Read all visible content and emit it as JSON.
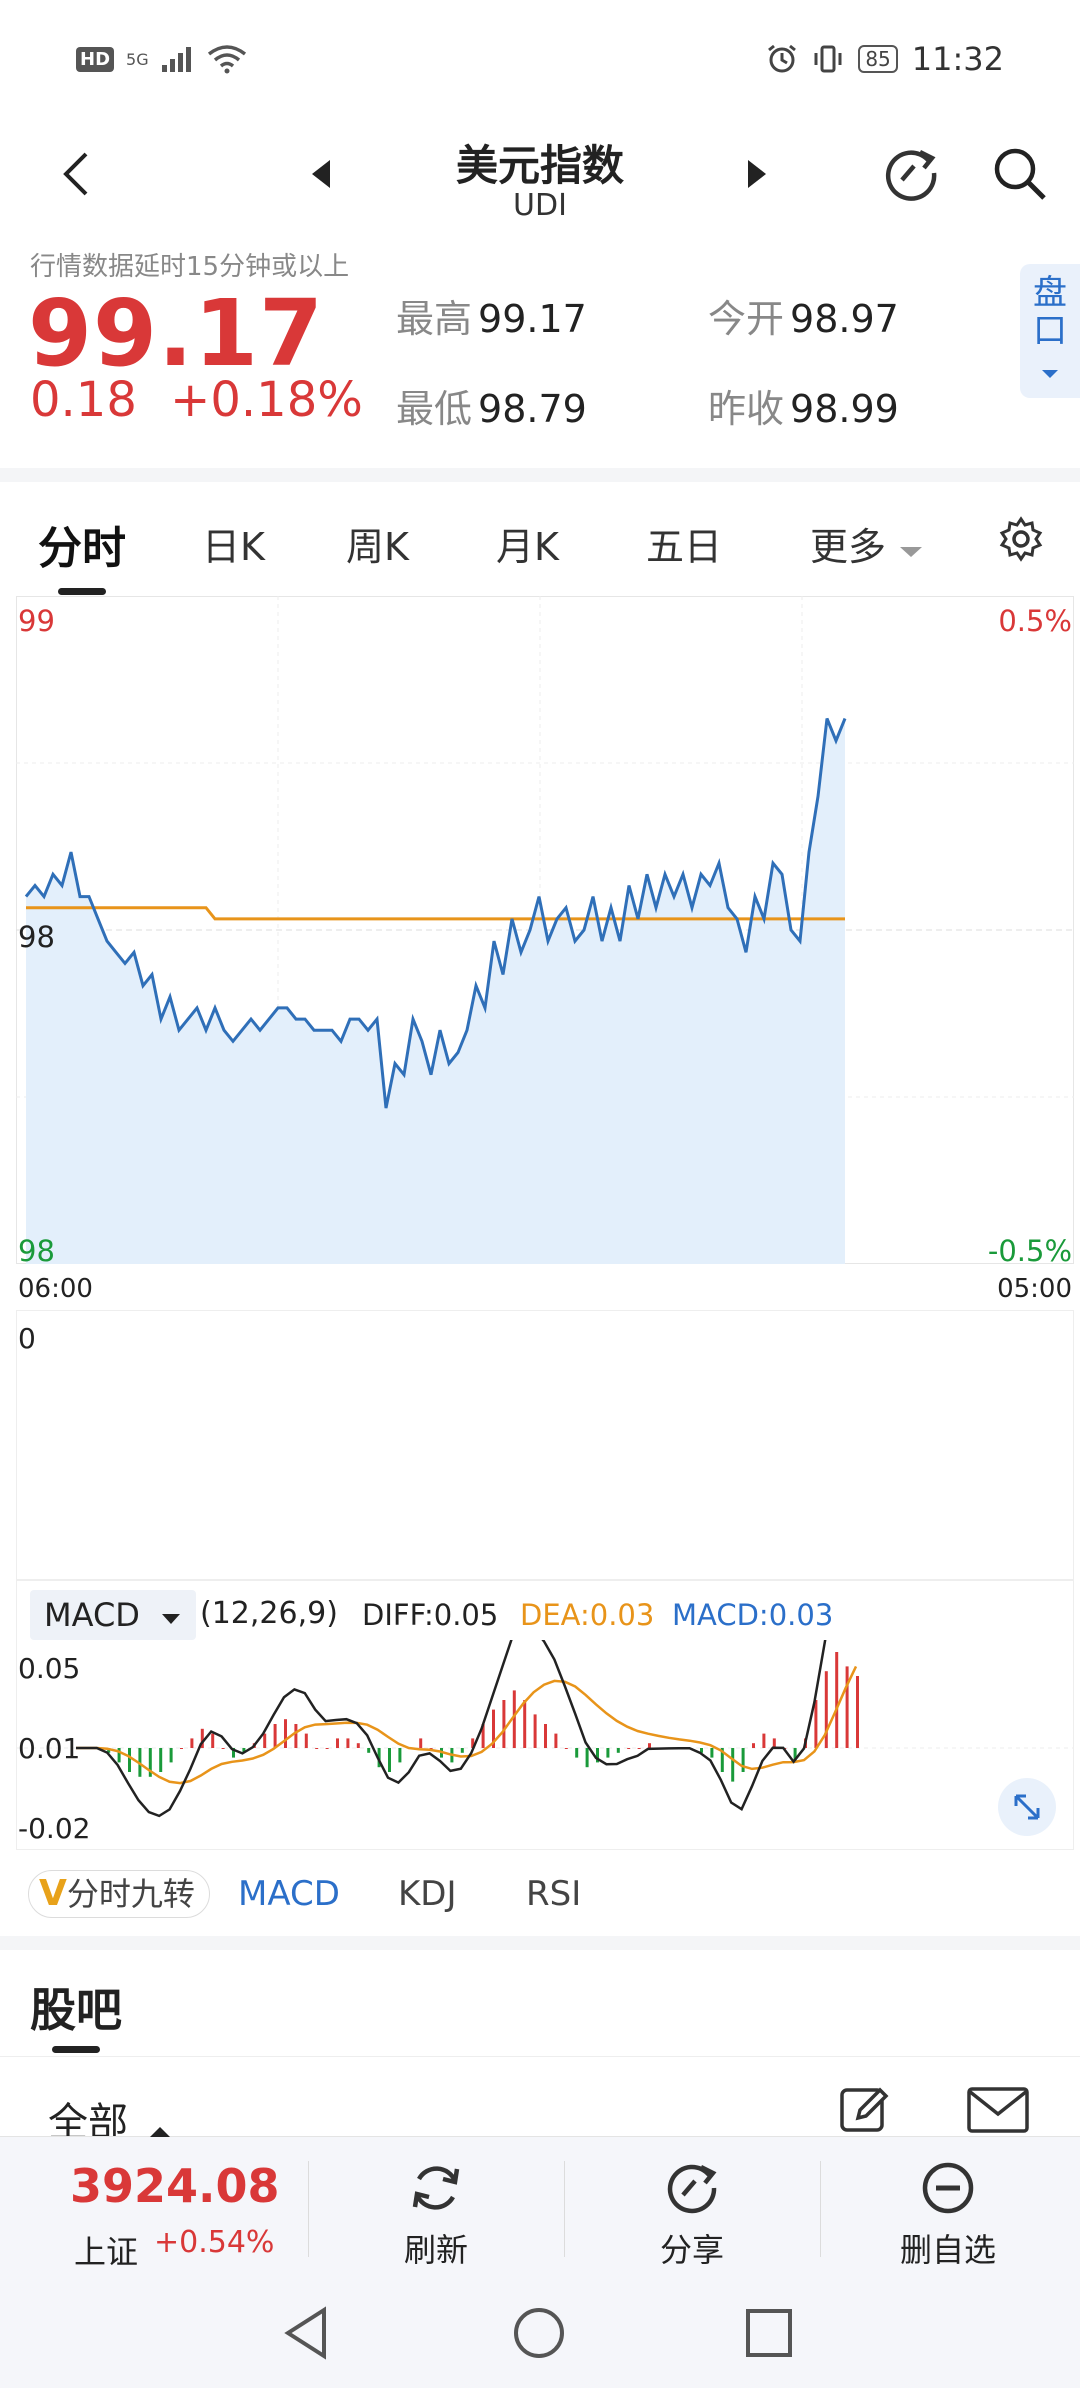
{
  "status_bar": {
    "network_badge": "HD",
    "signal_label": "5G",
    "battery": "85",
    "time": "11:32"
  },
  "header": {
    "title": "美元指数",
    "code": "UDI"
  },
  "quote": {
    "delay_notice": "行情数据延时15分钟或以上",
    "price": "99.17",
    "change": "0.18",
    "change_pct": "+0.18%",
    "high_label": "最高",
    "high": "99.17",
    "open_label": "今开",
    "open": "98.97",
    "low_label": "最低",
    "low": "98.79",
    "prev_close_label": "昨收",
    "prev_close": "98.99",
    "pankou_label": "盘口"
  },
  "tabs": [
    "分时",
    "日K",
    "周K",
    "月K",
    "五日",
    "更多"
  ],
  "chart": {
    "y_top_label": "99",
    "y_mid_label": "98",
    "y_bottom_label": "98",
    "pct_top_label": "0.5%",
    "pct_bottom_label": "-0.5%",
    "x_start": "06:00",
    "x_end": "05:00",
    "volume_label": "0"
  },
  "macd": {
    "selector": "MACD",
    "params": "(12,26,9)",
    "diff": "DIFF:0.05",
    "dea": "DEA:0.03",
    "macd": "MACD:0.03",
    "y_top": "0.05",
    "y_mid": "0.01",
    "y_bottom": "-0.02"
  },
  "indicator_tabs": {
    "chip": "分时九转",
    "chip_badge": "V",
    "items": [
      "MACD",
      "KDJ",
      "RSI"
    ]
  },
  "guba": {
    "title": "股吧",
    "filter": "全部"
  },
  "toolbar": {
    "index_value": "3924.08",
    "index_name": "上证",
    "index_pct": "+0.54%",
    "refresh": "刷新",
    "share": "分享",
    "remove_watch": "删自选"
  },
  "colors": {
    "up": "#d93838",
    "down": "#1a9a3a",
    "price_line": "#2f6fb8",
    "avg_line": "#e8941a",
    "accent": "#2b6fc9"
  },
  "chart_data": {
    "type": "line",
    "series": [
      {
        "values": [
          98.98,
          98.99,
          98.98,
          99.0,
          98.99,
          99.02,
          98.98,
          98.98,
          98.96,
          98.94,
          98.93,
          98.92,
          98.93,
          98.9,
          98.91,
          98.87,
          98.89,
          98.86,
          98.87,
          98.88,
          98.86,
          98.88,
          98.86,
          98.85,
          98.86,
          98.87,
          98.86,
          98.87,
          98.88,
          98.88,
          98.87,
          98.87,
          98.86,
          98.86,
          98.86,
          98.85,
          98.87,
          98.87,
          98.86,
          98.87,
          98.79,
          98.83,
          98.82,
          98.87,
          98.85,
          98.82,
          98.86,
          98.83,
          98.84,
          98.86,
          98.9,
          98.88,
          98.94,
          98.91,
          98.96,
          98.93,
          98.95,
          98.98,
          98.94,
          98.96,
          98.97,
          98.94,
          98.95,
          98.98,
          98.94,
          98.97,
          98.94,
          98.99,
          98.96,
          99.0,
          98.97,
          99.0,
          98.98,
          99.0,
          98.97,
          99.0,
          98.99,
          99.01,
          98.97,
          98.96,
          98.93,
          98.98,
          98.96,
          99.01,
          99.0,
          98.95,
          98.94,
          99.02,
          99.07,
          99.14,
          99.12,
          99.14
        ]
      },
      {
        "values": [
          98.97,
          98.97,
          98.97,
          98.97,
          98.97,
          98.97,
          98.97,
          98.97,
          98.97,
          98.97,
          98.97,
          98.97,
          98.97,
          98.97,
          98.97,
          98.97,
          98.97,
          98.97,
          98.97,
          98.97,
          98.97,
          98.96,
          98.96,
          98.96,
          98.96,
          98.96,
          98.96,
          98.96,
          98.96,
          98.96,
          98.96,
          98.96,
          98.96,
          98.96,
          98.96,
          98.96,
          98.96,
          98.96,
          98.96,
          98.96,
          98.96,
          98.96,
          98.96,
          98.96,
          98.96,
          98.96,
          98.96,
          98.96,
          98.96,
          98.96,
          98.96,
          98.96,
          98.96,
          98.96,
          98.96,
          98.96,
          98.96,
          98.96,
          98.96,
          98.96,
          98.96,
          98.96,
          98.96,
          98.96,
          98.96,
          98.96,
          98.96,
          98.96,
          98.96,
          98.96,
          98.96,
          98.96,
          98.96,
          98.96,
          98.96,
          98.96,
          98.96,
          98.96,
          98.96,
          98.96,
          98.96,
          98.96,
          98.96,
          98.96,
          98.96,
          98.96,
          98.96,
          98.96,
          98.96,
          98.96,
          98.96,
          98.96
        ]
      }
    ],
    "macd_hist": [
      0.0,
      0.0,
      0.0,
      -0.002,
      -0.006,
      -0.01,
      -0.012,
      -0.012,
      -0.01,
      -0.006,
      0.0,
      0.004,
      0.008,
      0.006,
      0.0,
      -0.004,
      -0.002,
      0.002,
      0.006,
      0.01,
      0.012,
      0.01,
      0.006,
      0.0,
      0.0,
      0.004,
      0.004,
      0.002,
      -0.002,
      -0.008,
      -0.01,
      -0.006,
      0.0,
      0.004,
      0.0,
      -0.004,
      -0.006,
      -0.002,
      0.004,
      0.01,
      0.016,
      0.02,
      0.024,
      0.02,
      0.014,
      0.01,
      0.006,
      0.0,
      -0.004,
      -0.008,
      -0.006,
      -0.004,
      -0.002,
      0.0,
      0.0,
      0.002,
      0.0,
      0.0,
      0.0,
      0.0,
      -0.002,
      -0.004,
      -0.01,
      -0.014,
      -0.01,
      0.002,
      0.006,
      0.004,
      0.0,
      -0.006,
      0.004,
      0.02,
      0.032,
      0.04,
      0.034,
      0.03
    ],
    "x_range": [
      "06:00",
      "05:00"
    ]
  }
}
